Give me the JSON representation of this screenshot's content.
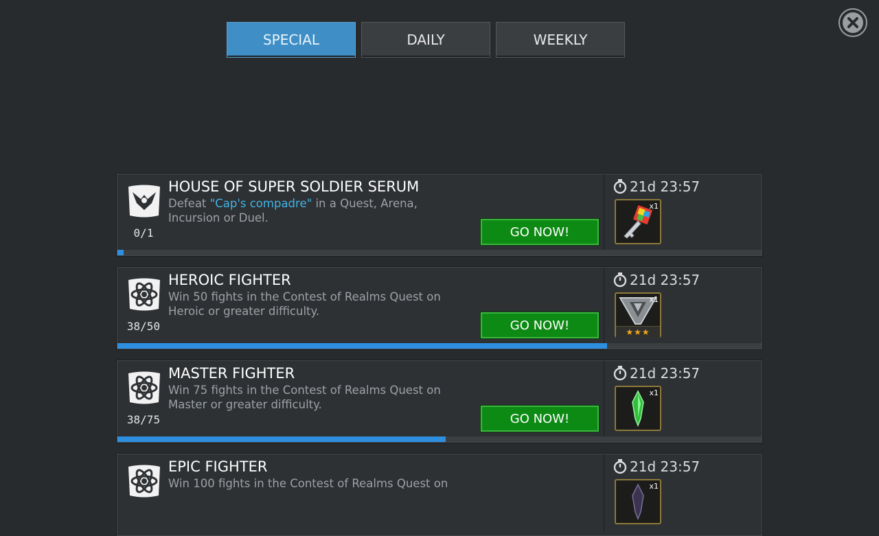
{
  "tabs": [
    {
      "label": "SPECIAL",
      "active": true
    },
    {
      "label": "DAILY",
      "active": false
    },
    {
      "label": "WEEKLY",
      "active": false
    }
  ],
  "quests": [
    {
      "icon": "eagle-emblem-icon",
      "title": "HOUSE OF SUPER SOLDIER SERUM",
      "desc_pre": "Defeat ",
      "desc_highlight": "\"Cap's compadre\"",
      "desc_post": " in a Quest, Arena, Incursion or Duel.",
      "count": "0/1",
      "progress": 0.01,
      "button": "GO NOW!",
      "timer": "21d 23:57",
      "reward": {
        "icon": "colorful-key-icon",
        "qty": "x1",
        "stars": ""
      }
    },
    {
      "icon": "atom-emblem-icon",
      "title": "HEROIC FIGHTER",
      "desc_pre": "Win 50 fights in the Contest of Realms Quest on Heroic or greater difficulty.",
      "desc_highlight": "",
      "desc_post": "",
      "count": "38/50",
      "progress": 0.76,
      "button": "GO NOW!",
      "timer": "21d 23:57",
      "reward": {
        "icon": "silver-shard-icon",
        "qty": "x1",
        "stars": "★★★"
      }
    },
    {
      "icon": "atom-emblem-icon",
      "title": "MASTER FIGHTER",
      "desc_pre": "Win 75 fights in the Contest of Realms Quest on Master or greater difficulty.",
      "desc_highlight": "",
      "desc_post": "",
      "count": "38/75",
      "progress": 0.51,
      "button": "GO NOW!",
      "timer": "21d 23:57",
      "reward": {
        "icon": "green-crystal-icon",
        "qty": "x1",
        "stars": ""
      }
    },
    {
      "icon": "atom-emblem-icon",
      "title": "EPIC FIGHTER",
      "desc_pre": "Win 100 fights in the Contest of Realms Quest on",
      "desc_highlight": "",
      "desc_post": "",
      "count": "",
      "progress": 0,
      "button": "",
      "timer": "21d 23:57",
      "reward": {
        "icon": "dark-crystal-icon",
        "qty": "x1",
        "stars": ""
      }
    }
  ],
  "colors": {
    "accent": "#3f8fc6",
    "go_button": "#0d8a13",
    "progress": "#2e8fe0",
    "highlight": "#41b4e6"
  }
}
